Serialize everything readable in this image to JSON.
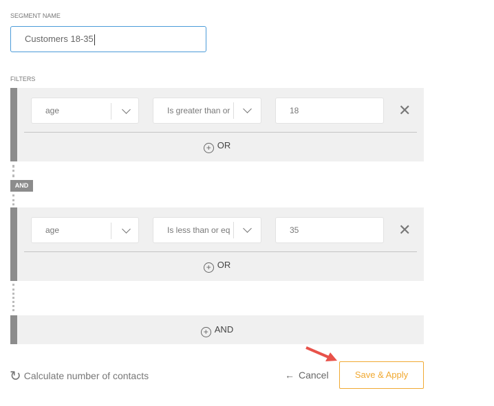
{
  "segment": {
    "label": "SEGMENT NAME",
    "value": "Customers 18-35"
  },
  "filters": {
    "label": "FILTERS",
    "groups": [
      {
        "field": "age",
        "operator": "Is greater than or",
        "value": "18",
        "or_label": "OR"
      },
      {
        "field": "age",
        "operator": "Is less than or eq",
        "value": "35",
        "or_label": "OR"
      }
    ],
    "and_badge": "AND",
    "add_and_label": "AND"
  },
  "footer": {
    "calculate_label": "Calculate number of contacts",
    "cancel_label": "Cancel",
    "save_label": "Save & Apply"
  },
  "colors": {
    "accent": "#f0a830",
    "focus": "#4a9ad8",
    "arrow": "#e8524a"
  }
}
